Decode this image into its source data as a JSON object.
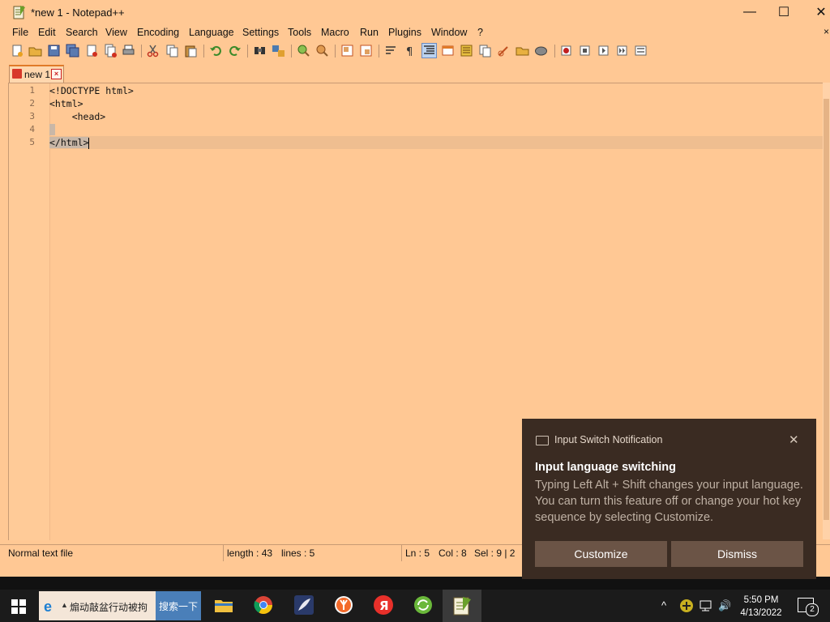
{
  "window": {
    "title": "*new 1 - Notepad++",
    "min_glyph": "—",
    "max_glyph": "☐",
    "close_glyph": "✕"
  },
  "menu": {
    "items": [
      "File",
      "Edit",
      "Search",
      "View",
      "Encoding",
      "Language",
      "Settings",
      "Tools",
      "Macro",
      "Run",
      "Plugins",
      "Window",
      "?"
    ],
    "right_close": "×"
  },
  "toolbar": {
    "buttons": [
      "new-file",
      "open-file",
      "save",
      "save-all",
      "close",
      "close-all",
      "print",
      "cut",
      "copy",
      "paste",
      "undo",
      "redo",
      "find",
      "replace",
      "zoom-in",
      "zoom-out",
      "sync-vertical",
      "sync-horizontal",
      "word-wrap",
      "show-all-chars",
      "indent-guide",
      "user-defined-language",
      "document-map",
      "function-list",
      "folder-as-workspace",
      "monitoring",
      "record-macro",
      "stop-recording",
      "playback-macro",
      "run-macro-multiple",
      "save-macro"
    ]
  },
  "tabs": [
    {
      "label": "new 1",
      "close": "×"
    }
  ],
  "editor": {
    "lines": [
      {
        "num": "1",
        "text": "<!DOCTYPE html>"
      },
      {
        "num": "2",
        "text": "<html>"
      },
      {
        "num": "3",
        "text": "    <head>"
      },
      {
        "num": "4",
        "text": ""
      },
      {
        "num": "5",
        "text": "</html>"
      }
    ]
  },
  "statusbar": {
    "file_type": "Normal text file",
    "length": "length : 43",
    "lines": "lines : 5",
    "ln": "Ln : 5",
    "col": "Col : 8",
    "sel": "Sel : 9 | 2"
  },
  "notification": {
    "header": "Input Switch Notification",
    "close": "✕",
    "title": "Input language switching",
    "body": "Typing Left Alt + Shift changes your input language. You can turn this feature off or change your hot key sequence by selecting Customize.",
    "customize": "Customize",
    "dismiss": "Dismiss"
  },
  "taskbar": {
    "search_text": "煽动敲盆行动被拘",
    "search_button": "搜索一下",
    "ie_glyph": "e",
    "arrow_glyph": "▲",
    "clock_time": "5:50 PM",
    "clock_date": "4/13/2022",
    "notification_count": "2",
    "tray_chevron": "^",
    "tray_volume": "🔊"
  },
  "colors": {
    "app_bg": "#ffc894",
    "notification_bg": "#3a2b22",
    "taskbar_bg": "#1b1b1b",
    "search_button": "#4a7fb9"
  }
}
